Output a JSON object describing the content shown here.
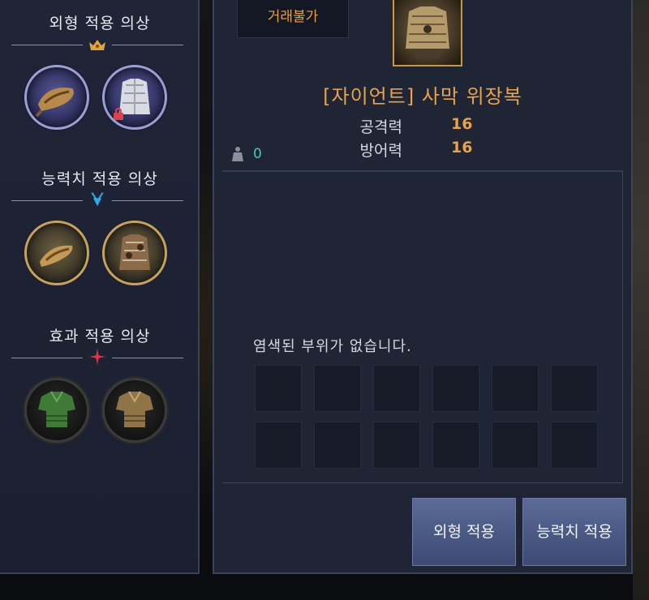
{
  "left_panel": {
    "sections": [
      {
        "title": "외형 적용 의상",
        "emblem": "crown-icon",
        "emblem_color": "#e3a33c",
        "slots": [
          {
            "icon": "weapon-costume-icon",
            "style": "purple",
            "locked": false
          },
          {
            "icon": "armor-costume-icon",
            "style": "purple",
            "locked": true
          }
        ]
      },
      {
        "title": "능력치 적용 의상",
        "emblem": "crossed-swords-icon",
        "emblem_color": "#2fa8e6",
        "slots": [
          {
            "icon": "weapon-costume-icon",
            "style": "gold"
          },
          {
            "icon": "armor-costume-icon",
            "style": "gold"
          }
        ]
      },
      {
        "title": "효과 적용 의상",
        "emblem": "spark-icon",
        "emblem_color": "#e8304a",
        "slots": [
          {
            "icon": "green-top-icon",
            "style": "dark"
          },
          {
            "icon": "gold-top-icon",
            "style": "dark"
          }
        ]
      }
    ]
  },
  "item": {
    "trade_label": "거래불가",
    "name": "[자이언트] 사막 위장복",
    "stats": [
      {
        "label": "공격력",
        "value": "16"
      },
      {
        "label": "방어력",
        "value": "16"
      }
    ],
    "weight": "0"
  },
  "dye": {
    "message": "염색된 부위가 없습니다.",
    "slot_count": 12
  },
  "buttons": {
    "appearance": "외형 적용",
    "stats": "능력치 적용"
  }
}
